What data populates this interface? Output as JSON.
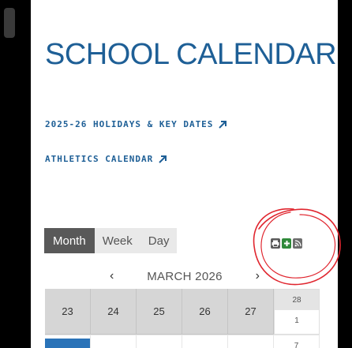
{
  "page": {
    "title": "SCHOOL CALENDAR",
    "links": [
      {
        "label": "2025-26 HOLIDAYS & KEY DATES"
      },
      {
        "label": "ATHLETICS CALENDAR"
      }
    ]
  },
  "calendar": {
    "views": [
      "Month",
      "Week",
      "Day"
    ],
    "active_view": "Month",
    "nav": {
      "prev": "‹",
      "next": "›",
      "month_label": "MARCH 2026"
    },
    "week_row": [
      "23",
      "24",
      "25",
      "26",
      "27"
    ],
    "current_cell": {
      "top_date": "28",
      "second_date": "1"
    },
    "next_row_last": "7"
  },
  "tools": [
    "print-icon",
    "add-icon",
    "rss-icon"
  ],
  "colors": {
    "brand_blue": "#1e5f96",
    "active_view": "#595959",
    "add_green": "#2f8a3a",
    "event_blue": "#2a73b8",
    "annotation_red": "#e0262f"
  }
}
